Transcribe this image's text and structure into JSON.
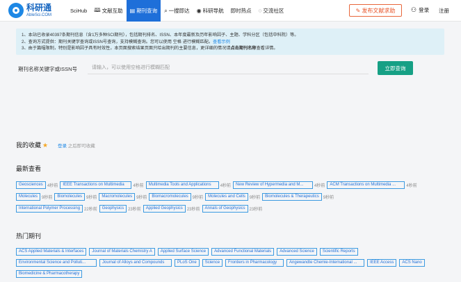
{
  "header": {
    "logo_cn": "科研通",
    "logo_en": "AbleSci.COM",
    "nav": [
      {
        "label": "SciHub",
        "icon": ""
      },
      {
        "label": "文献互助",
        "icon": "book-icon"
      },
      {
        "label": "期刊查询",
        "icon": "journal-icon",
        "active": true
      },
      {
        "label": "一搜即达",
        "icon": "search-icon"
      },
      {
        "label": "科研导航",
        "icon": "compass-icon"
      },
      {
        "label": "即时热点",
        "icon": ""
      },
      {
        "label": "交流社区",
        "icon": "chat-icon"
      }
    ],
    "publish": "发布文献求助",
    "login": "登录",
    "register": "注册"
  },
  "info": {
    "line1": "1、本站已收录40397条期刊信息（含1万多种SCI期刊），包括期刊排名、ISSN、本年度最新及历年影响因子、主题、学科分区（包括中科院）等。",
    "line2_a": "2、查询方式提供：期刊关键字查询或ISSN号查询，支持模糊查询。您可以使用 空格 进行模糊匹配。",
    "line2_link": "查看示例",
    "line3_a": "3、由于篇幅限制，特别是影响因子具有时效性，本页面搜索结果页面只给出期刊的主要信息，更详细的情况请",
    "line3_strong": "点击期刊名称",
    "line3_b": "查看详情。"
  },
  "search": {
    "label": "期刊名称关键字或ISSN号",
    "placeholder": "请输入，可以使用空格进行模糊匹配",
    "button": "立即查询"
  },
  "favorites": {
    "title": "我的收藏",
    "hint_link": "登录",
    "hint_text": " 之后即可收藏"
  },
  "recent": {
    "title": "最新查看",
    "rows": [
      [
        {
          "name": "Geosciences",
          "time": "4秒前"
        },
        {
          "name": "IEEE Transactions on Multimedia",
          "time": "4秒前"
        },
        {
          "name": "Multimedia Tools and Applications",
          "time": "4秒前"
        },
        {
          "name": "New Review of Hypermedia and M...",
          "time": "4秒前"
        },
        {
          "name": "ACM Transactions on Multimedia ...",
          "time": "4秒前"
        }
      ],
      [
        {
          "name": "Molecules",
          "time": "9秒前"
        },
        {
          "name": "Biomolecules",
          "time": "9秒前"
        },
        {
          "name": "Macromolecules",
          "time": "9秒前"
        },
        {
          "name": "Biomacromolecules",
          "time": "9秒前"
        },
        {
          "name": "Molecules and Cells",
          "time": "9秒前"
        },
        {
          "name": "Biomolecules & Therapeutics",
          "time": "9秒前"
        }
      ],
      [
        {
          "name": "International Polymer Processing",
          "time": "22秒前"
        },
        {
          "name": "Geophysics",
          "time": "23秒前"
        },
        {
          "name": "Applied Geophysics",
          "time": "23秒前"
        },
        {
          "name": "Annals of Geophysics",
          "time": "23秒前"
        }
      ]
    ]
  },
  "hot": {
    "title": "热门期刊",
    "rows": [
      [
        "ACS Applied Materials & Interfaces",
        "Journal of Materials Chemistry A",
        "Applied Surface Science",
        "Advanced Functional Materials",
        "Advanced Science",
        "Scientific Reports"
      ],
      [
        "Environmental Science and Polluti...",
        "Journal of Alloys and Compounds",
        "PLoS One",
        "Science",
        "Frontiers in Pharmacology",
        "Angewandte Chemie-International ...",
        "IEEE Access",
        "ACS Nano"
      ],
      [
        "Biomedicine & Pharmacotherapy"
      ]
    ]
  }
}
